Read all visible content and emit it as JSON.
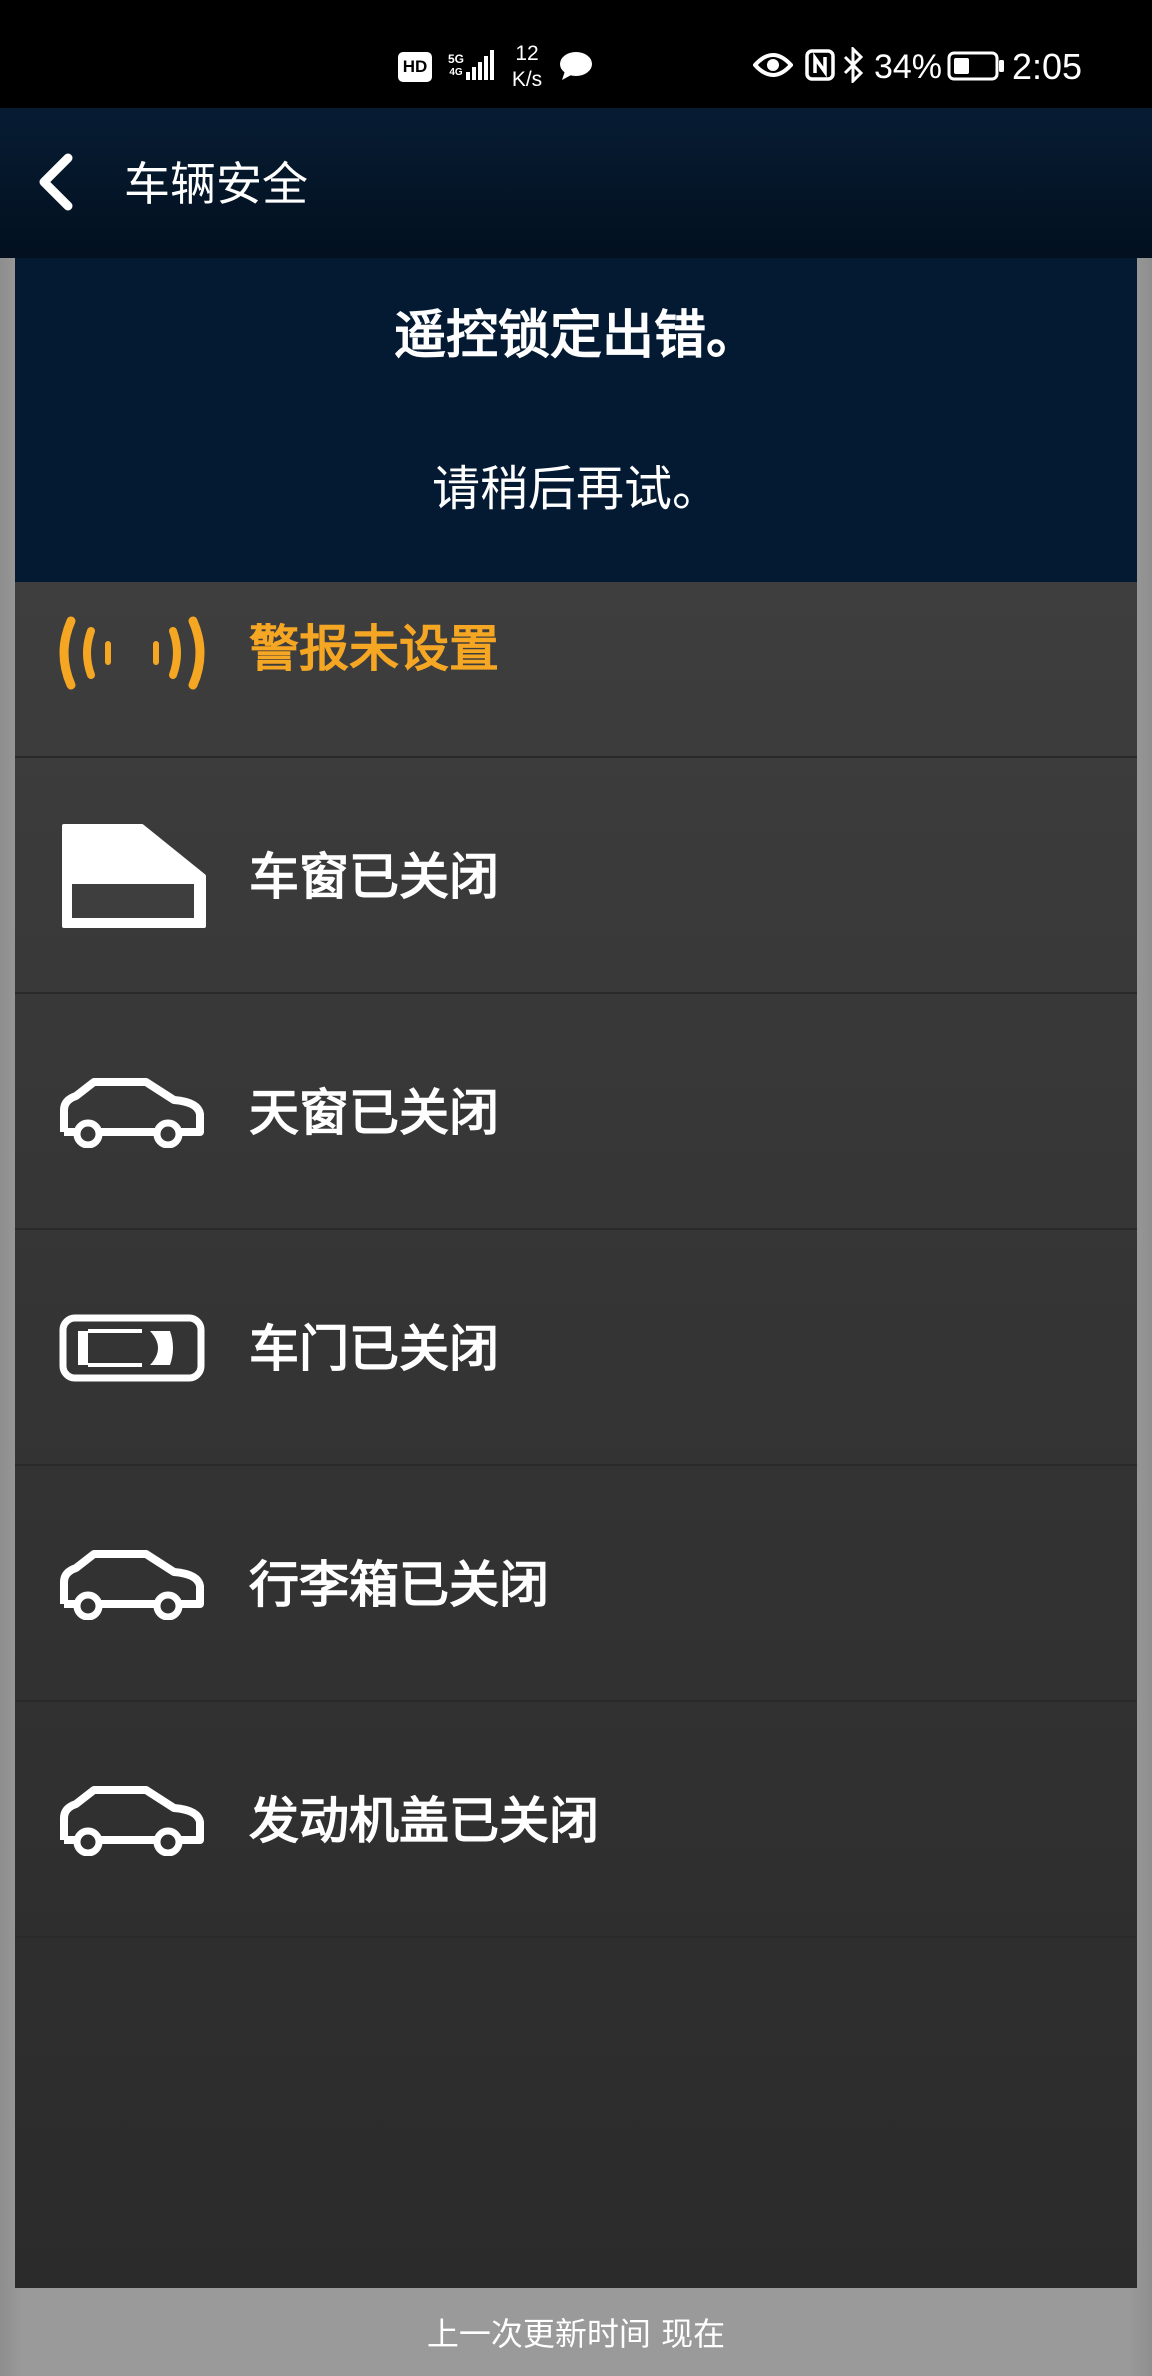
{
  "status_bar": {
    "hd": "HD",
    "network_5g": "5G",
    "network_sub": "4G",
    "speed_value": "12",
    "speed_unit": "K/s",
    "battery_percent": "34%",
    "time": "2:05"
  },
  "header": {
    "title": "车辆安全",
    "back_icon": "chevron-left-icon"
  },
  "error": {
    "title": "遥控锁定出错。",
    "message": "请稍后再试。"
  },
  "status_items": [
    {
      "label": "警报未设置",
      "icon": "alarm-signal-icon",
      "color": "#f5a623"
    },
    {
      "label": "车窗已关闭",
      "icon": "window-icon"
    },
    {
      "label": "天窗已关闭",
      "icon": "car-sunroof-icon"
    },
    {
      "label": "车门已关闭",
      "icon": "car-door-icon"
    },
    {
      "label": "行李箱已关闭",
      "icon": "car-trunk-icon"
    },
    {
      "label": "发动机盖已关闭",
      "icon": "car-hood-icon"
    }
  ],
  "footer": {
    "last_update": "上一次更新时间 现在"
  },
  "colors": {
    "banner": "#041a33",
    "warning": "#f5a623",
    "panel": "#3a3a3a"
  }
}
